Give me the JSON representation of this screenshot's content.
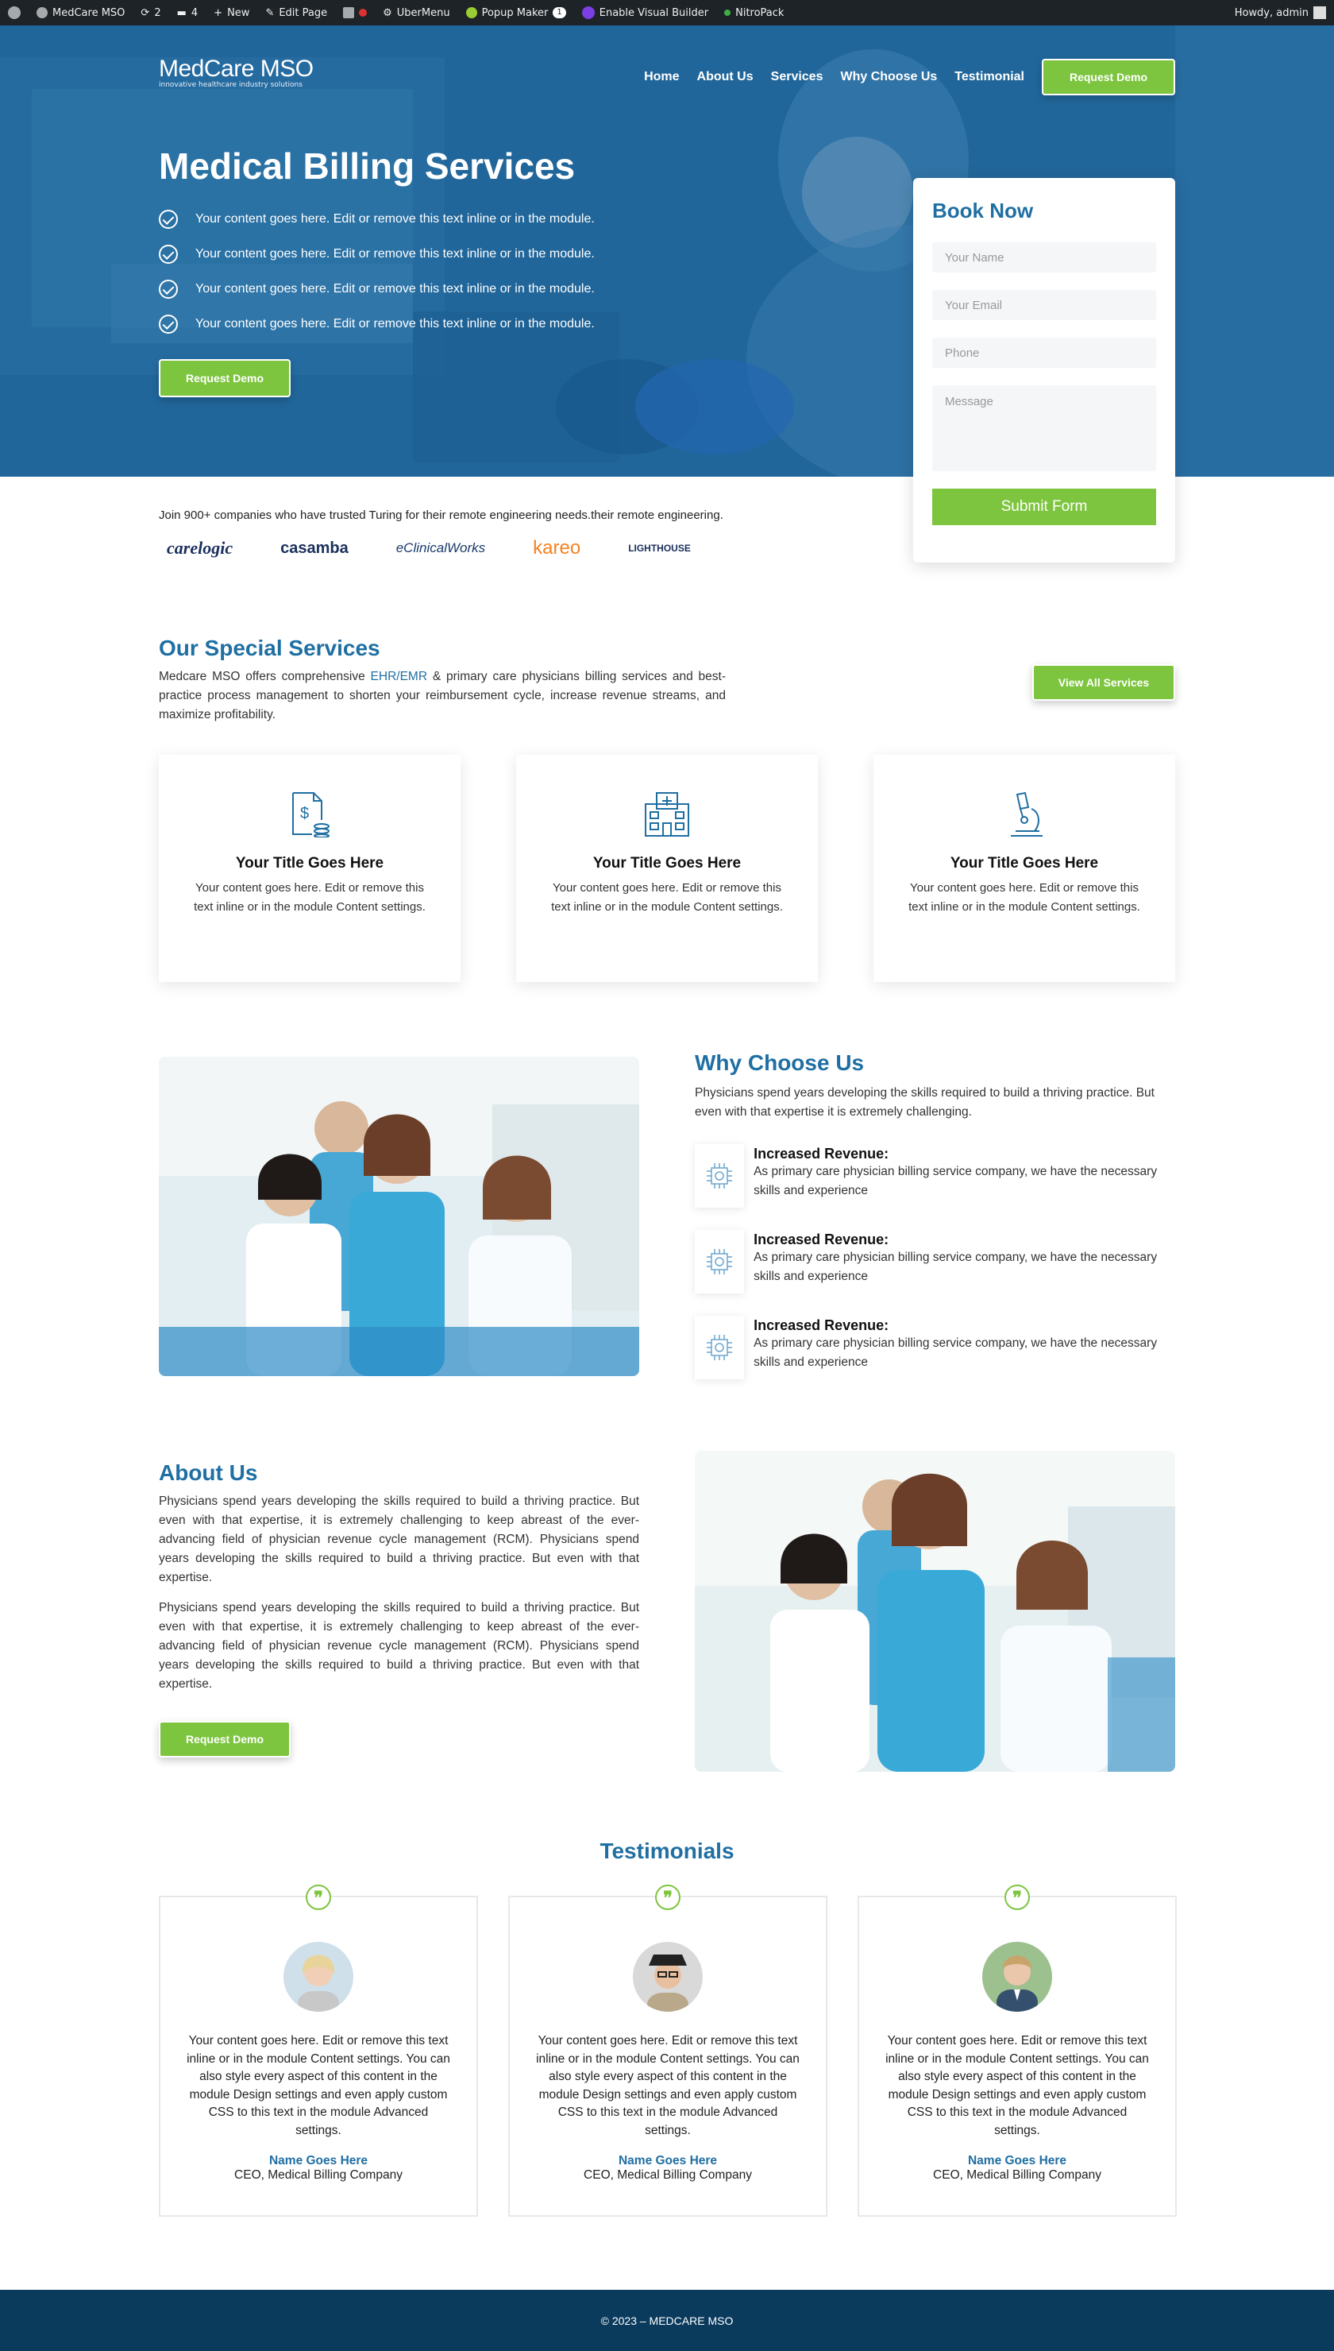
{
  "admin_bar": {
    "site_name": "MedCare MSO",
    "updates_count": "2",
    "comments_count": "4",
    "new_label": "New",
    "edit_page_label": "Edit Page",
    "ubermenu_label": "UberMenu",
    "popup_maker_label": "Popup Maker",
    "popup_maker_count": "1",
    "visual_builder_label": "Enable Visual Builder",
    "nitropack_label": "NitroPack",
    "greeting": "Howdy, admin"
  },
  "nav": {
    "logo_name": "MedCare MSO",
    "logo_tagline": "innovative healthcare industry solutions",
    "items": [
      {
        "label": "Home"
      },
      {
        "label": "About Us"
      },
      {
        "label": "Services"
      },
      {
        "label": "Why Choose Us"
      },
      {
        "label": "Testimonial"
      }
    ],
    "cta_label": "Request Demo"
  },
  "hero": {
    "title": "Medical Billing Services",
    "checks": [
      "Your content goes here. Edit or remove this text inline or in the module.",
      "Your content goes here. Edit or remove this text inline or in the module.",
      "Your content goes here. Edit or remove this text inline or in the module.",
      "Your content goes here. Edit or remove this text inline or in the module."
    ],
    "cta_label": "Request Demo"
  },
  "book_form": {
    "title": "Book Now",
    "name_placeholder": "Your Name",
    "email_placeholder": "Your Email",
    "phone_placeholder": "Phone",
    "message_placeholder": "Message",
    "submit_label": "Submit Form"
  },
  "trusted": {
    "text": "Join 900+ companies who have trusted Turing for their remote engineering needs.their remote engineering.",
    "logos": [
      "carelogic",
      "casamba",
      "eClinicalWorks",
      "kareo",
      "LIGHTHOUSE"
    ]
  },
  "services": {
    "title": "Our Special Services",
    "desc_before": "Medcare MSO offers comprehensive ",
    "desc_link": "EHR/EMR",
    "desc_after": " & primary care physicians billing services and best-practice process management to shorten your reimbursement cycle, increase revenue streams, and maximize profitability.",
    "view_all_label": "View All Services",
    "cards": [
      {
        "icon": "invoice-dollar-icon",
        "title": "Your Title Goes Here",
        "text": "Your content goes here. Edit or remove this text inline or in the module Content settings."
      },
      {
        "icon": "hospital-icon",
        "title": "Your Title Goes Here",
        "text": "Your content goes here. Edit or remove this text inline or in the module Content settings."
      },
      {
        "icon": "microscope-icon",
        "title": "Your Title Goes Here",
        "text": "Your content goes here. Edit or remove this text inline or in the module Content settings."
      }
    ]
  },
  "why": {
    "title": "Why Choose Us",
    "desc": "Physicians spend years developing the skills required to build a thriving practice. But even with that expertise it is extremely challenging.",
    "items": [
      {
        "title": "Increased Revenue:",
        "text": "As primary care physician billing service company, we have the necessary skills and experience"
      },
      {
        "title": "Increased Revenue:",
        "text": "As primary care physician billing service company, we have the necessary skills and experience"
      },
      {
        "title": "Increased Revenue:",
        "text": "As primary care physician billing service company, we have the necessary skills and experience"
      }
    ]
  },
  "about": {
    "title": "About Us",
    "p1": "Physicians spend years developing the skills required to build a thriving practice. But even with that expertise, it is extremely challenging to keep abreast of the ever- advancing field of physician revenue cycle management (RCM). Physicians spend years developing the skills required to build a thriving practice. But even with that expertise.",
    "p2": "Physicians spend years developing the skills required to build a thriving practice. But even with that expertise, it is extremely challenging to keep abreast of the ever- advancing field of physician revenue cycle management (RCM). Physicians spend years developing the skills required to build a thriving practice. But even with that expertise.",
    "cta_label": "Request Demo"
  },
  "testimonials": {
    "title": "Testimonials",
    "items": [
      {
        "text": "Your content goes here. Edit or remove this text inline or in the module Content settings. You can also style every aspect of this content in the module Design settings and even apply custom CSS to this text in the module Advanced settings.",
        "name": "Name Goes Here",
        "role": "CEO, Medical Billing Company"
      },
      {
        "text": "Your content goes here. Edit or remove this text inline or in the module Content settings. You can also style every aspect of this content in the module Design settings and even apply custom CSS to this text in the module Advanced settings.",
        "name": "Name Goes Here",
        "role": "CEO, Medical Billing Company"
      },
      {
        "text": "Your content goes here. Edit or remove this text inline or in the module Content settings. You can also style every aspect of this content in the module Design settings and even apply custom CSS to this text in the module Advanced settings.",
        "name": "Name Goes Here",
        "role": "CEO, Medical Billing Company"
      }
    ]
  },
  "footer": {
    "text": "© 2023 – MEDCARE MSO"
  },
  "colors": {
    "primary": "#1f6fa3",
    "accent": "#7dc53f",
    "footer": "#0a3a5c",
    "admin_bar": "#1d2327"
  }
}
